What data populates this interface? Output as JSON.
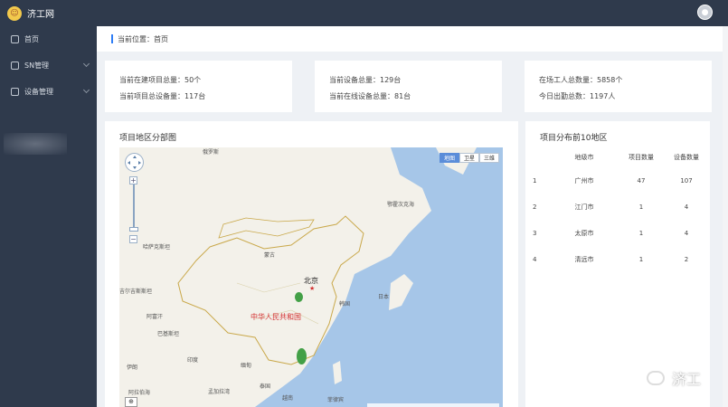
{
  "app": {
    "title": "济工网"
  },
  "sidebar": {
    "items": [
      {
        "label": "首页",
        "icon": "display-icon",
        "expandable": false
      },
      {
        "label": "SN管理",
        "icon": "home-icon",
        "expandable": true
      },
      {
        "label": "设备管理",
        "icon": "device-icon",
        "expandable": true
      }
    ]
  },
  "breadcrumb": {
    "prefix": "当前位置：",
    "page": "首页"
  },
  "stats": {
    "projects": {
      "line1": "当前在建项目总量：50个",
      "line2": "当前项目总设备量：117台"
    },
    "devices": {
      "line1": "当前设备总量：129台",
      "line2": "当前在线设备总量：81台"
    },
    "workers": {
      "line1": "在场工人总数量：5858个",
      "line2": "今日出勤总数：1197人"
    }
  },
  "map_panel": {
    "title": "项目地区分部图",
    "map_types": [
      "地图",
      "卫星",
      "三维"
    ],
    "active_map_type": "地图",
    "labels": {
      "country": "中华人民共和国",
      "capital": "北京",
      "places": [
        "哈萨克斯坦",
        "蒙古",
        "吉尔吉斯斯坦",
        "阿富汗",
        "巴基斯坦",
        "印度",
        "缅甸",
        "泰国",
        "越南",
        "孟加拉湾",
        "菲律宾",
        "韩国",
        "日本",
        "鄂霍次克海",
        "伊朗",
        "阿拉伯海",
        "俄罗斯"
      ]
    },
    "markers_color": "#43a047"
  },
  "top_regions": {
    "title": "项目分布前10地区",
    "columns": [
      "",
      "地级市",
      "项目数量",
      "设备数量"
    ],
    "rows": [
      [
        "1",
        "广州市",
        "47",
        "107"
      ],
      [
        "2",
        "江门市",
        "1",
        "4"
      ],
      [
        "3",
        "太原市",
        "1",
        "4"
      ],
      [
        "4",
        "清远市",
        "1",
        "2"
      ]
    ]
  },
  "watermark": {
    "text": "济工"
  }
}
